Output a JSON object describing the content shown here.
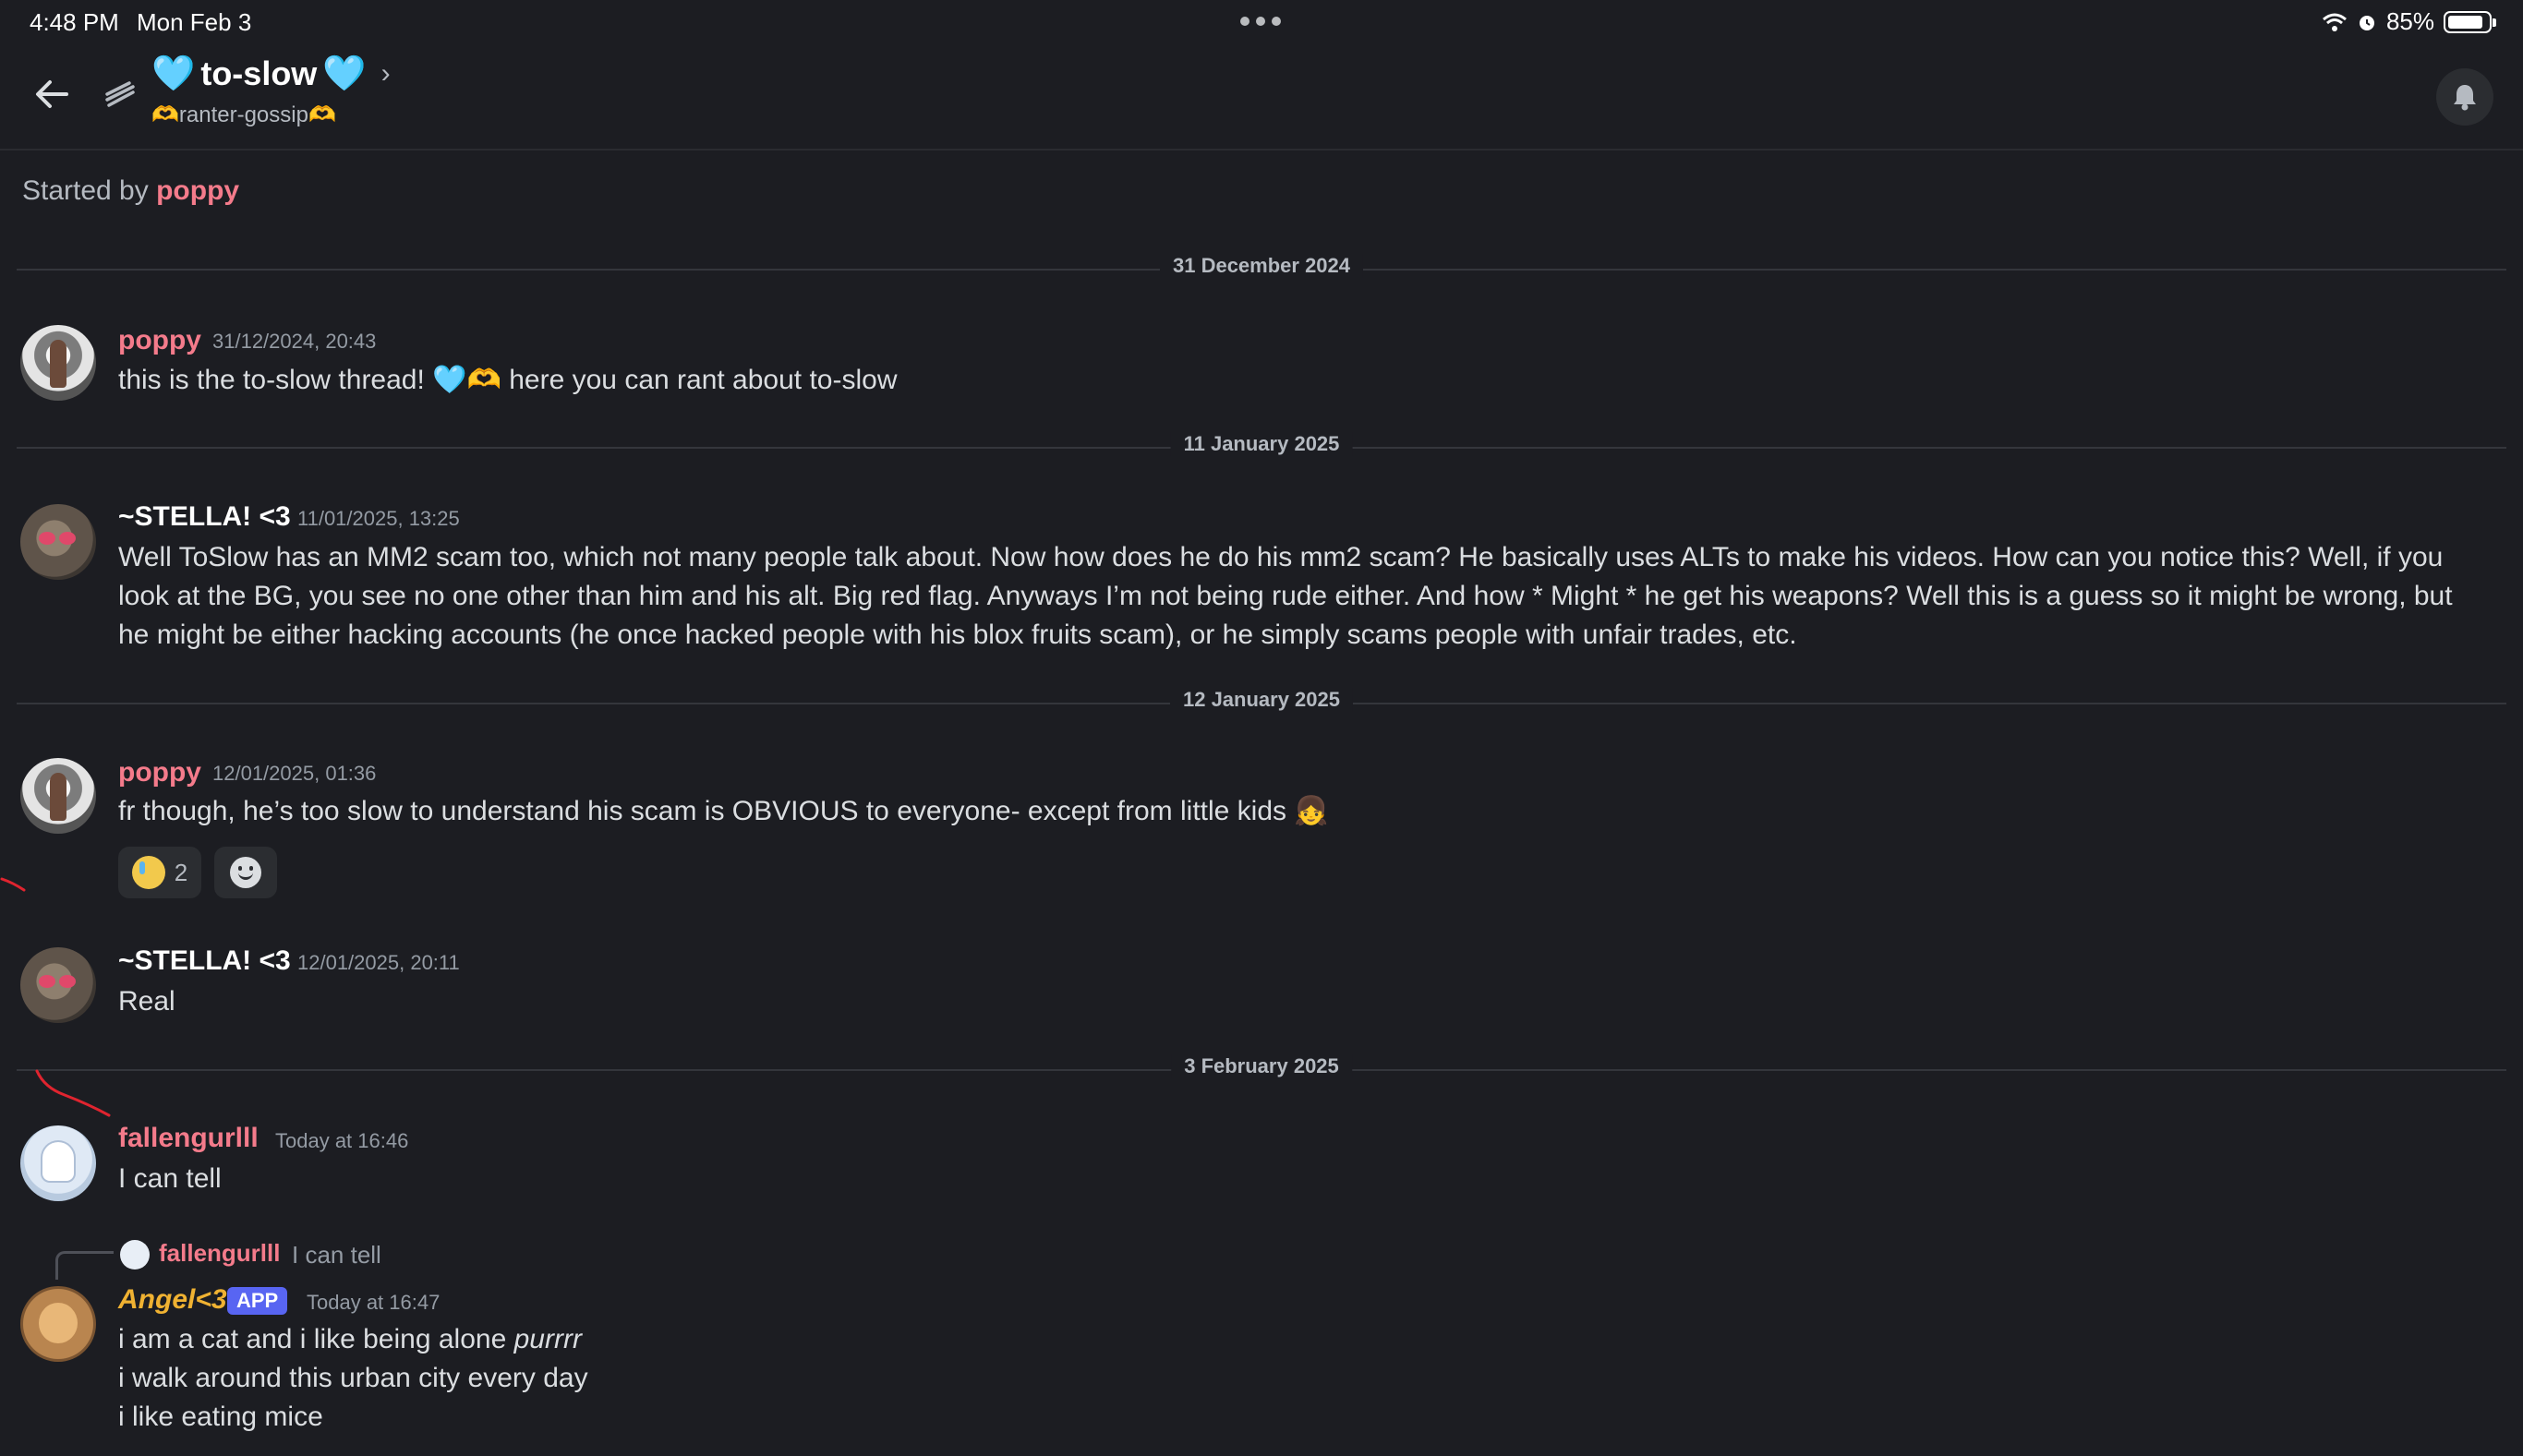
{
  "status": {
    "time": "4:48 PM",
    "date": "Mon Feb 3",
    "battery": "85%"
  },
  "header": {
    "title_emoji_left": "🩵",
    "title": "to-slow",
    "title_emoji_right": "🩵",
    "subtitle_emoji_left": "🫶",
    "subtitle": "ranter-gossip",
    "subtitle_emoji_right": "🫶"
  },
  "thread": {
    "started_prefix": "Started by",
    "started_by": "poppy"
  },
  "dividers": [
    "31 December 2024",
    "11 January 2025",
    "12 January 2025",
    "3 February 2025"
  ],
  "messages": [
    {
      "author": "poppy",
      "timestamp": "31/12/2024, 20:43",
      "text": "this is the to-slow thread!",
      "emoji": [
        "🩵",
        "🫶"
      ],
      "text_after": "here you can rant about to-slow"
    },
    {
      "author": "~STELLA! <3",
      "timestamp": "11/01/2025, 13:25",
      "text": "Well ToSlow has an MM2 scam too, which not many people talk about. Now how does he do his mm2 scam? He basically uses ALTs to make his videos. How can you notice this? Well, if you look at the BG, you see no one other than him and his alt. Big red flag. Anyways I’m not being rude either. And how * Might * he get his weapons? Well this is a guess so it might be wrong, but he might be either hacking accounts (he once hacked people with his blox fruits scam), or he simply scams people with unfair trades, etc."
    },
    {
      "author": "poppy",
      "timestamp": "12/01/2025, 01:36",
      "text": "fr though, he’s too slow to understand his scam is OBVIOUS to everyone- except from little kids",
      "emoji": [
        "👧"
      ],
      "reaction_count": "2"
    },
    {
      "author": "~STELLA! <3",
      "timestamp": "12/01/2025, 20:11",
      "text": "Real"
    },
    {
      "author": "fallengurlll",
      "timestamp": "Today at 16:46",
      "text": "I can tell"
    },
    {
      "author": "Angel<3",
      "badge": "APP",
      "timestamp": "Today at 16:47",
      "reply_to": {
        "author": "fallengurlll",
        "text": "I can tell"
      },
      "lines": [
        "i am a cat and i like being alone",
        "i walk around this urban city every day",
        "i like eating mice"
      ],
      "line1_italic": "purrrr"
    }
  ],
  "colors": {
    "background": "#1c1d22",
    "name_pink": "#f47b8b",
    "name_gold": "#f0b232",
    "app_badge": "#5865f2",
    "annotation_red": "#e0242f"
  }
}
